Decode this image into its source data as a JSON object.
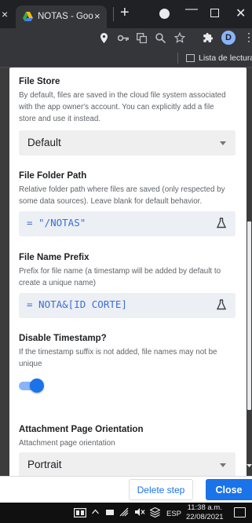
{
  "browser": {
    "tab_title": "NOTAS - Goo",
    "tab_close": "×",
    "left_close": "×",
    "new_tab": "+",
    "window_min": "—",
    "window_close": "✕",
    "reading_list_label": "Lista de lectura",
    "profile_initial": "D",
    "menu_dots": "⋮"
  },
  "fields": {
    "file_store": {
      "label": "File Store",
      "description": "By default, files are saved in the cloud file system associated with the app owner's account. You can explicitly add a file store and use it instead.",
      "value": "Default"
    },
    "file_folder_path": {
      "label": "File Folder Path",
      "description": "Relative folder path where files are saved (only respected by some data sources). Leave blank for default behavior.",
      "value": "= \"/NOTAS\""
    },
    "file_name_prefix": {
      "label": "File Name Prefix",
      "description": "Prefix for file name (a timestamp will be added by default to create a unique name)",
      "value": "= NOTA&[ID CORTE]"
    },
    "disable_timestamp": {
      "label": "Disable Timestamp?",
      "description": "If the timestamp suffix is not added, file names may not be unique",
      "enabled": true
    },
    "attachment_orientation": {
      "label": "Attachment Page Orientation",
      "description": "Attachment page orientation",
      "value": "Portrait"
    }
  },
  "footer": {
    "delete_label": "Delete step",
    "close_label": "Close"
  },
  "taskbar": {
    "language": "ESP",
    "time": "11:38 a.m.",
    "date": "22/08/2021"
  },
  "colors": {
    "accent": "#1a73e8",
    "formula_text": "#3b6fd6"
  }
}
